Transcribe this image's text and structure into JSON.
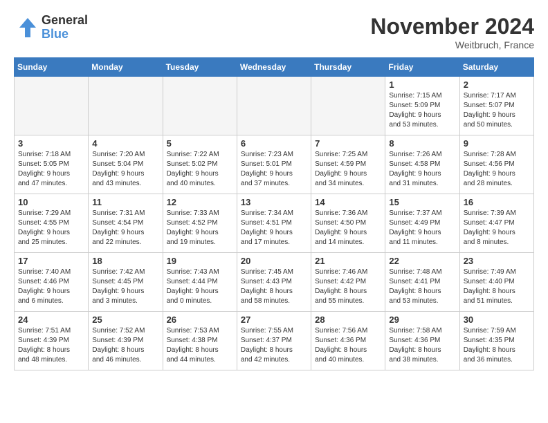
{
  "logo": {
    "general": "General",
    "blue": "Blue"
  },
  "title": "November 2024",
  "location": "Weitbruch, France",
  "days_of_week": [
    "Sunday",
    "Monday",
    "Tuesday",
    "Wednesday",
    "Thursday",
    "Friday",
    "Saturday"
  ],
  "weeks": [
    [
      {
        "day": "",
        "info": "",
        "empty": true
      },
      {
        "day": "",
        "info": "",
        "empty": true
      },
      {
        "day": "",
        "info": "",
        "empty": true
      },
      {
        "day": "",
        "info": "",
        "empty": true
      },
      {
        "day": "",
        "info": "",
        "empty": true
      },
      {
        "day": "1",
        "info": "Sunrise: 7:15 AM\nSunset: 5:09 PM\nDaylight: 9 hours\nand 53 minutes."
      },
      {
        "day": "2",
        "info": "Sunrise: 7:17 AM\nSunset: 5:07 PM\nDaylight: 9 hours\nand 50 minutes."
      }
    ],
    [
      {
        "day": "3",
        "info": "Sunrise: 7:18 AM\nSunset: 5:05 PM\nDaylight: 9 hours\nand 47 minutes."
      },
      {
        "day": "4",
        "info": "Sunrise: 7:20 AM\nSunset: 5:04 PM\nDaylight: 9 hours\nand 43 minutes."
      },
      {
        "day": "5",
        "info": "Sunrise: 7:22 AM\nSunset: 5:02 PM\nDaylight: 9 hours\nand 40 minutes."
      },
      {
        "day": "6",
        "info": "Sunrise: 7:23 AM\nSunset: 5:01 PM\nDaylight: 9 hours\nand 37 minutes."
      },
      {
        "day": "7",
        "info": "Sunrise: 7:25 AM\nSunset: 4:59 PM\nDaylight: 9 hours\nand 34 minutes."
      },
      {
        "day": "8",
        "info": "Sunrise: 7:26 AM\nSunset: 4:58 PM\nDaylight: 9 hours\nand 31 minutes."
      },
      {
        "day": "9",
        "info": "Sunrise: 7:28 AM\nSunset: 4:56 PM\nDaylight: 9 hours\nand 28 minutes."
      }
    ],
    [
      {
        "day": "10",
        "info": "Sunrise: 7:29 AM\nSunset: 4:55 PM\nDaylight: 9 hours\nand 25 minutes."
      },
      {
        "day": "11",
        "info": "Sunrise: 7:31 AM\nSunset: 4:54 PM\nDaylight: 9 hours\nand 22 minutes."
      },
      {
        "day": "12",
        "info": "Sunrise: 7:33 AM\nSunset: 4:52 PM\nDaylight: 9 hours\nand 19 minutes."
      },
      {
        "day": "13",
        "info": "Sunrise: 7:34 AM\nSunset: 4:51 PM\nDaylight: 9 hours\nand 17 minutes."
      },
      {
        "day": "14",
        "info": "Sunrise: 7:36 AM\nSunset: 4:50 PM\nDaylight: 9 hours\nand 14 minutes."
      },
      {
        "day": "15",
        "info": "Sunrise: 7:37 AM\nSunset: 4:49 PM\nDaylight: 9 hours\nand 11 minutes."
      },
      {
        "day": "16",
        "info": "Sunrise: 7:39 AM\nSunset: 4:47 PM\nDaylight: 9 hours\nand 8 minutes."
      }
    ],
    [
      {
        "day": "17",
        "info": "Sunrise: 7:40 AM\nSunset: 4:46 PM\nDaylight: 9 hours\nand 6 minutes."
      },
      {
        "day": "18",
        "info": "Sunrise: 7:42 AM\nSunset: 4:45 PM\nDaylight: 9 hours\nand 3 minutes."
      },
      {
        "day": "19",
        "info": "Sunrise: 7:43 AM\nSunset: 4:44 PM\nDaylight: 9 hours\nand 0 minutes."
      },
      {
        "day": "20",
        "info": "Sunrise: 7:45 AM\nSunset: 4:43 PM\nDaylight: 8 hours\nand 58 minutes."
      },
      {
        "day": "21",
        "info": "Sunrise: 7:46 AM\nSunset: 4:42 PM\nDaylight: 8 hours\nand 55 minutes."
      },
      {
        "day": "22",
        "info": "Sunrise: 7:48 AM\nSunset: 4:41 PM\nDaylight: 8 hours\nand 53 minutes."
      },
      {
        "day": "23",
        "info": "Sunrise: 7:49 AM\nSunset: 4:40 PM\nDaylight: 8 hours\nand 51 minutes."
      }
    ],
    [
      {
        "day": "24",
        "info": "Sunrise: 7:51 AM\nSunset: 4:39 PM\nDaylight: 8 hours\nand 48 minutes."
      },
      {
        "day": "25",
        "info": "Sunrise: 7:52 AM\nSunset: 4:39 PM\nDaylight: 8 hours\nand 46 minutes."
      },
      {
        "day": "26",
        "info": "Sunrise: 7:53 AM\nSunset: 4:38 PM\nDaylight: 8 hours\nand 44 minutes."
      },
      {
        "day": "27",
        "info": "Sunrise: 7:55 AM\nSunset: 4:37 PM\nDaylight: 8 hours\nand 42 minutes."
      },
      {
        "day": "28",
        "info": "Sunrise: 7:56 AM\nSunset: 4:36 PM\nDaylight: 8 hours\nand 40 minutes."
      },
      {
        "day": "29",
        "info": "Sunrise: 7:58 AM\nSunset: 4:36 PM\nDaylight: 8 hours\nand 38 minutes."
      },
      {
        "day": "30",
        "info": "Sunrise: 7:59 AM\nSunset: 4:35 PM\nDaylight: 8 hours\nand 36 minutes."
      }
    ]
  ]
}
